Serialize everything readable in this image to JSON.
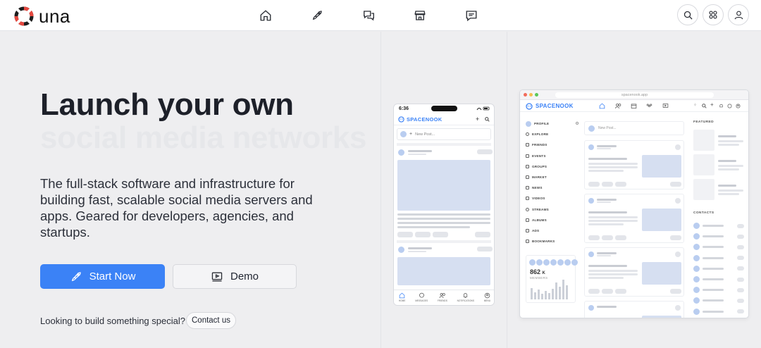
{
  "brand": {
    "name": "una",
    "accent": "#3b82f6",
    "logo_red": "#e5483f"
  },
  "nav": {
    "icons": [
      "home-icon",
      "rocket-icon",
      "chat-icon",
      "store-icon",
      "message-icon"
    ],
    "right": [
      "search-icon",
      "apps-icon",
      "user-icon"
    ]
  },
  "hero": {
    "title_line1": "Launch your own",
    "title_line2": "social media networks",
    "description": "The full-stack software and infrastructure for building fast, scalable social media servers and apps. Geared for developers, agencies, and startups.",
    "start_label": "Start Now",
    "demo_label": "Demo",
    "special_text": "Looking to build something special?",
    "contact_label": "Contact us"
  },
  "phone": {
    "time": "6:36",
    "brand": "SPACENOOK",
    "new_post": "New Post...",
    "tabs": [
      "HOME",
      "MESSAGES",
      "FRIENDS",
      "NOTIFICATIONS",
      "MENU"
    ]
  },
  "desktop": {
    "url": "spacenook.app",
    "brand": "SPACENOOK",
    "new_post": "New Post...",
    "sidebar": [
      "PROFILE",
      "EXPLORE",
      "FRIENDS",
      "EVENTS",
      "GROUPS",
      "MARKET",
      "NEWS",
      "VIDEOS",
      "STREAMS",
      "ALBUMS",
      "ADS",
      "BOOKMARKS"
    ],
    "members_count": "862",
    "members_suffix": "K",
    "members_label": "MEMBERS",
    "featured_label": "FEATURED",
    "contacts_label": "CONTACTS"
  }
}
